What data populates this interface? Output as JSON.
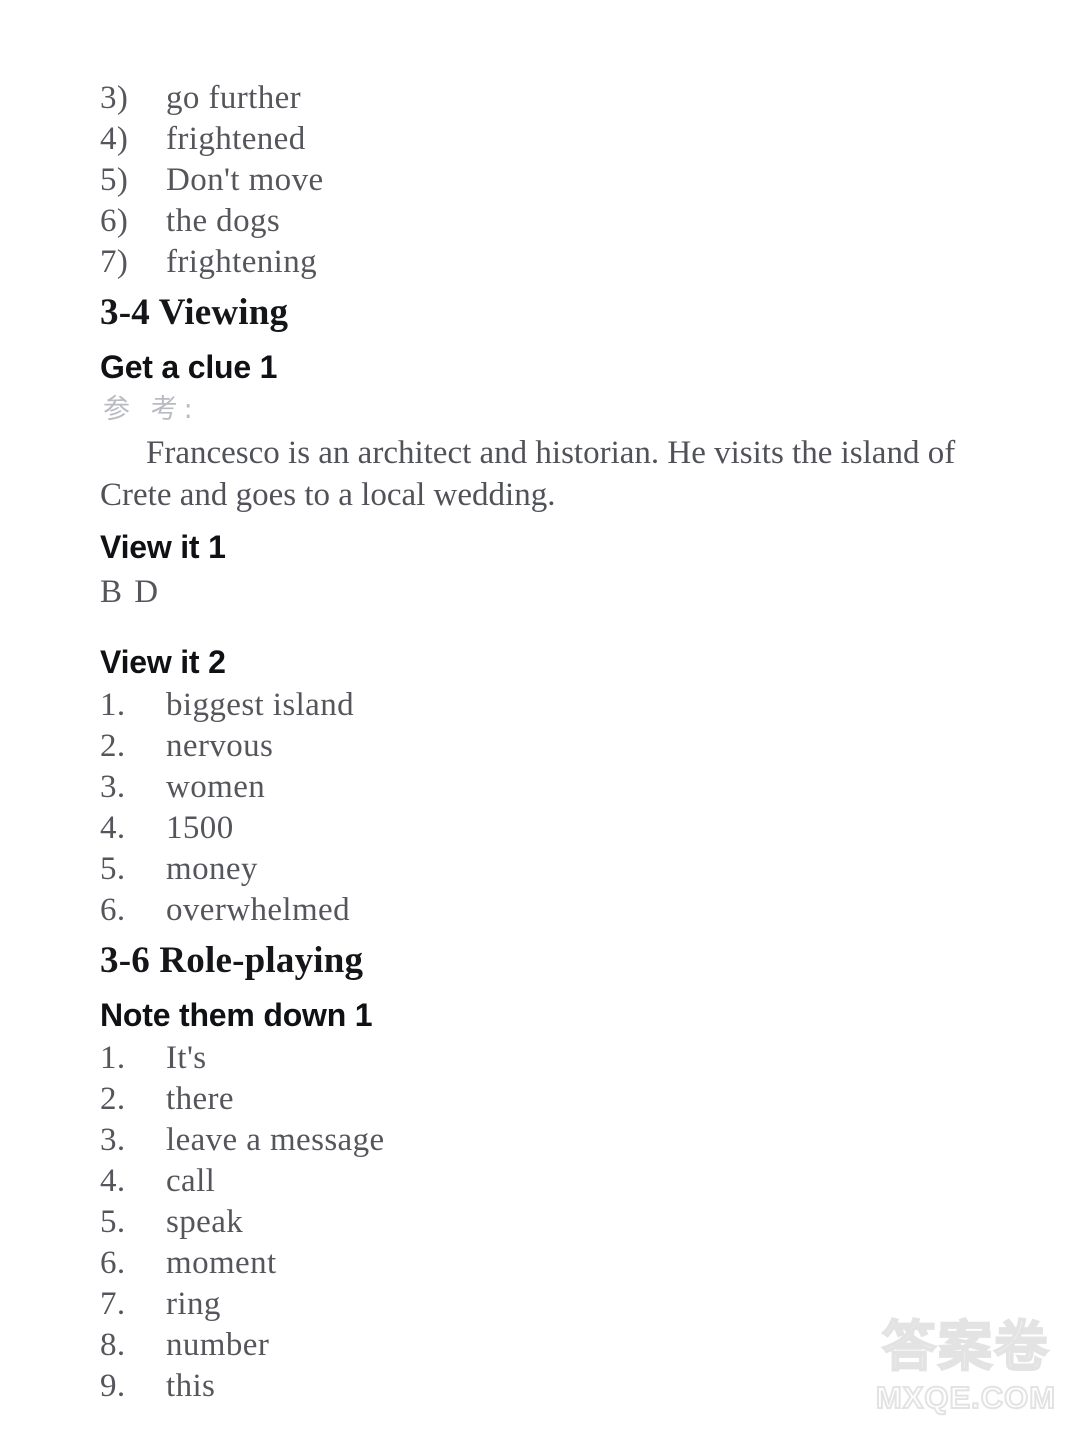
{
  "page": {
    "background_color": "#ffffff",
    "text_color": "#3a3b42",
    "heading_color": "#15161a"
  },
  "answers_continued": {
    "items": [
      {
        "num": "3)",
        "text": "go further"
      },
      {
        "num": "4)",
        "text": "frightened"
      },
      {
        "num": "5)",
        "text": "Don't move"
      },
      {
        "num": "6)",
        "text": "the dogs"
      },
      {
        "num": "7)",
        "text": "frightening"
      }
    ]
  },
  "section_viewing": {
    "title": "3-4 Viewing",
    "get_a_clue": {
      "heading": "Get a clue 1",
      "cjk_note": "参 考:",
      "paragraph": "Francesco is an architect and historian. He visits the island of Crete and goes to a local wedding."
    },
    "view_it_1": {
      "heading": "View it 1",
      "answer": "B D"
    },
    "view_it_2": {
      "heading": "View it 2",
      "items": [
        {
          "num": "1.",
          "text": "biggest island"
        },
        {
          "num": "2.",
          "text": "nervous"
        },
        {
          "num": "3.",
          "text": "women"
        },
        {
          "num": "4.",
          "text": "1500"
        },
        {
          "num": "5.",
          "text": "money"
        },
        {
          "num": "6.",
          "text": "overwhelmed"
        }
      ]
    }
  },
  "section_roleplaying": {
    "title": "3-6 Role-playing",
    "note_them_down": {
      "heading": "Note them down 1",
      "items": [
        {
          "num": "1.",
          "text": "It's"
        },
        {
          "num": "2.",
          "text": "there"
        },
        {
          "num": "3.",
          "text": "leave a message"
        },
        {
          "num": "4.",
          "text": "call"
        },
        {
          "num": "5.",
          "text": "speak"
        },
        {
          "num": "6.",
          "text": "moment"
        },
        {
          "num": "7.",
          "text": "ring"
        },
        {
          "num": "8.",
          "text": "number"
        },
        {
          "num": "9.",
          "text": "this"
        }
      ]
    }
  },
  "watermark": {
    "cjk": "答案卷",
    "domain": "MXQE.COM",
    "color": "#e3e3e3"
  }
}
